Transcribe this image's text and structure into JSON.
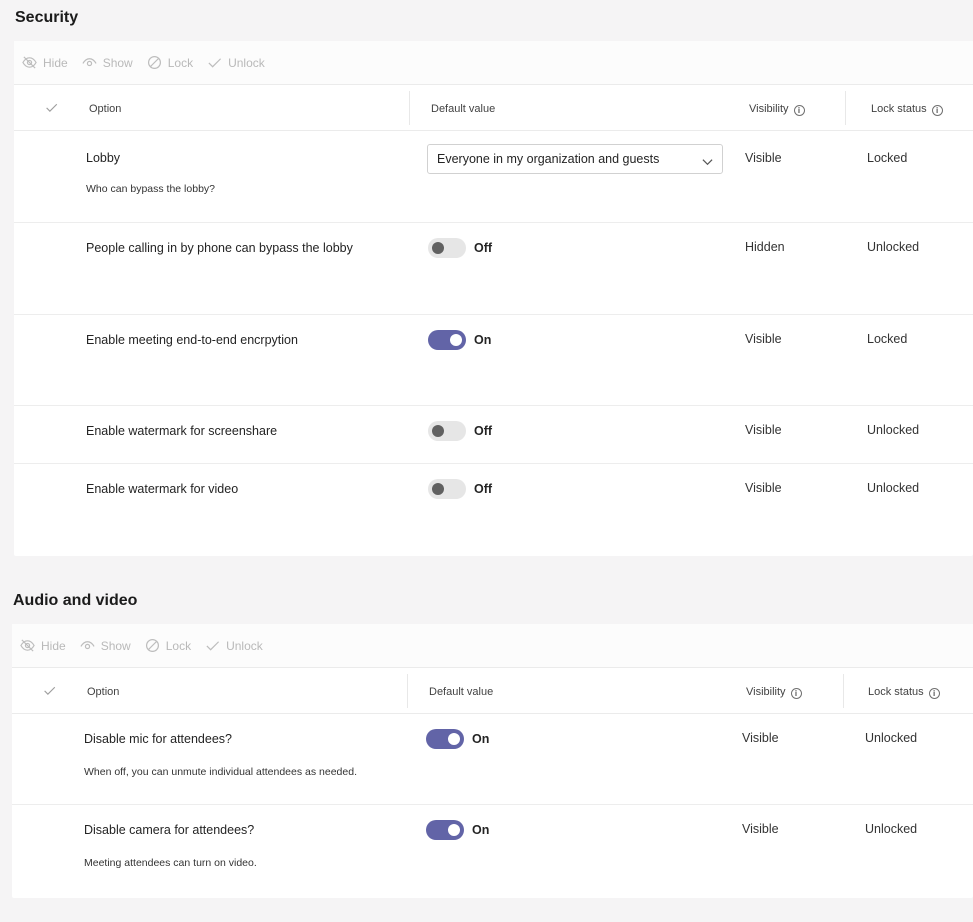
{
  "toolbar": {
    "hide": "Hide",
    "show": "Show",
    "lock": "Lock",
    "unlock": "Unlock"
  },
  "columns": {
    "option": "Option",
    "default_value": "Default value",
    "visibility": "Visibility",
    "lock_status": "Lock status",
    "info_glyph": "i"
  },
  "security": {
    "title": "Security",
    "rows": [
      {
        "option": "Lobby",
        "description": "Who can bypass the lobby?",
        "control": "dropdown",
        "value": "Everyone in my organization and guests",
        "visibility": "Visible",
        "lock": "Locked"
      },
      {
        "option": "People calling in by phone can bypass the lobby",
        "description": "",
        "control": "toggle",
        "value": "Off",
        "visibility": "Hidden",
        "lock": "Unlocked"
      },
      {
        "option": "Enable meeting end-to-end encrpytion",
        "description": "",
        "control": "toggle",
        "value": "On",
        "visibility": "Visible",
        "lock": "Locked"
      },
      {
        "option": "Enable watermark for screenshare",
        "description": "",
        "control": "toggle",
        "value": "Off",
        "visibility": "Visible",
        "lock": "Unlocked"
      },
      {
        "option": "Enable watermark for video",
        "description": "",
        "control": "toggle",
        "value": "Off",
        "visibility": "Visible",
        "lock": "Unlocked"
      }
    ]
  },
  "audio_video": {
    "title": "Audio and video",
    "rows": [
      {
        "option": "Disable mic for attendees?",
        "description": "When off, you can unmute individual attendees as needed.",
        "control": "toggle",
        "value": "On",
        "visibility": "Visible",
        "lock": "Unlocked"
      },
      {
        "option": "Disable camera for attendees?",
        "description": "Meeting attendees can turn on video.",
        "control": "toggle",
        "value": "On",
        "visibility": "Visible",
        "lock": "Unlocked"
      }
    ]
  },
  "colors": {
    "toggle_on": "#6264a7",
    "toggle_off_track": "#e6e6e6",
    "page_bg": "#f5f4f5"
  }
}
